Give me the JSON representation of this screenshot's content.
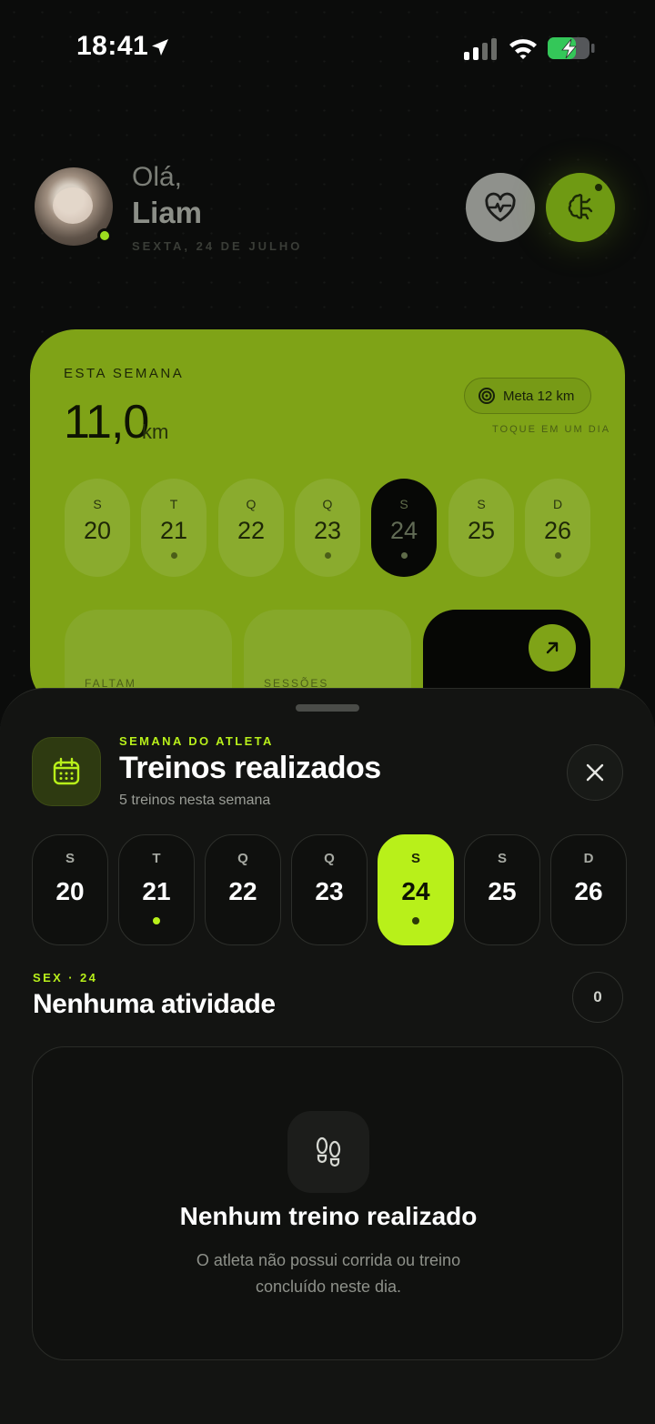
{
  "status_bar": {
    "time": "18:41"
  },
  "header": {
    "greeting": "Olá,",
    "name": "Liam",
    "date": "SEXTA, 24 DE JULHO"
  },
  "week_card": {
    "label": "ESTA SEMANA",
    "distance": "11,0",
    "unit": "km",
    "goal": "Meta 12 km",
    "hint": "TOQUE EM UM DIA",
    "days": [
      {
        "letter": "S",
        "num": "20",
        "dot": false,
        "selected": false
      },
      {
        "letter": "T",
        "num": "21",
        "dot": true,
        "selected": false
      },
      {
        "letter": "Q",
        "num": "22",
        "dot": false,
        "selected": false
      },
      {
        "letter": "Q",
        "num": "23",
        "dot": true,
        "selected": false
      },
      {
        "letter": "S",
        "num": "24",
        "dot": true,
        "selected": true
      },
      {
        "letter": "S",
        "num": "25",
        "dot": false,
        "selected": false
      },
      {
        "letter": "D",
        "num": "26",
        "dot": true,
        "selected": false
      }
    ],
    "tiles": [
      "FALTAM",
      "SESSÕES"
    ]
  },
  "sheet": {
    "kicker": "SEMANA DO ATLETA",
    "title": "Treinos realizados",
    "subtitle": "5 treinos nesta semana",
    "days": [
      {
        "letter": "S",
        "num": "20",
        "dot": false,
        "selected": false
      },
      {
        "letter": "T",
        "num": "21",
        "dot": true,
        "selected": false
      },
      {
        "letter": "Q",
        "num": "22",
        "dot": false,
        "selected": false
      },
      {
        "letter": "Q",
        "num": "23",
        "dot": false,
        "selected": false
      },
      {
        "letter": "S",
        "num": "24",
        "dot": true,
        "selected": true
      },
      {
        "letter": "S",
        "num": "25",
        "dot": false,
        "selected": false
      },
      {
        "letter": "D",
        "num": "26",
        "dot": false,
        "selected": false
      }
    ],
    "selected_label": "SEX · 24",
    "selected_title": "Nenhuma atividade",
    "count": "0",
    "empty_title": "Nenhum treino realizado",
    "empty_text": "O atleta não possui corrida ou treino concluído neste dia."
  },
  "colors": {
    "accent": "#b8f01a",
    "background": "#0b0c0b",
    "sheet": "#131412"
  }
}
